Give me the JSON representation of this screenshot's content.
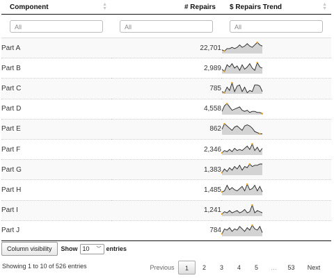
{
  "columns": {
    "component": "Component",
    "repairs": "# Repairs",
    "trend": "$ Repairs Trend"
  },
  "filters": {
    "component": "All",
    "repairs": "All",
    "trend": "All"
  },
  "rows": [
    {
      "component": "Part A",
      "repairs": "22,701",
      "trend": [
        3,
        2,
        4,
        4,
        5,
        4,
        5,
        7,
        5,
        6,
        8,
        6,
        5,
        7,
        9,
        7,
        6
      ]
    },
    {
      "component": "Part B",
      "repairs": "2,989",
      "trend": [
        4,
        2,
        8,
        6,
        9,
        5,
        7,
        3,
        8,
        4,
        6,
        9,
        5,
        3,
        10,
        6,
        5
      ]
    },
    {
      "component": "Part C",
      "repairs": "785",
      "trend": [
        2,
        1,
        6,
        3,
        10,
        2,
        7,
        8,
        2,
        6,
        1,
        3,
        2,
        8,
        8,
        7,
        2
      ]
    },
    {
      "component": "Part D",
      "repairs": "4,558",
      "trend": [
        3,
        8,
        10,
        7,
        4,
        5,
        6,
        7,
        4,
        3,
        4,
        2,
        3,
        3,
        2,
        2,
        1
      ]
    },
    {
      "component": "Part E",
      "repairs": "862",
      "trend": [
        5,
        10,
        8,
        6,
        4,
        7,
        8,
        6,
        4,
        8,
        9,
        8,
        6,
        3,
        2,
        1,
        1
      ]
    },
    {
      "component": "Part F",
      "repairs": "2,346",
      "trend": [
        2,
        4,
        3,
        5,
        3,
        6,
        4,
        5,
        4,
        6,
        8,
        5,
        10,
        4,
        7,
        3,
        6
      ]
    },
    {
      "component": "Part G",
      "repairs": "1,383",
      "trend": [
        2,
        5,
        3,
        6,
        4,
        7,
        5,
        8,
        4,
        7,
        6,
        9,
        7,
        8,
        8,
        9,
        9
      ]
    },
    {
      "component": "Part H",
      "repairs": "1,485",
      "trend": [
        3,
        4,
        9,
        5,
        7,
        5,
        4,
        6,
        8,
        4,
        10,
        5,
        6,
        9,
        4,
        8,
        3
      ]
    },
    {
      "component": "Part I",
      "repairs": "1,241",
      "trend": [
        2,
        4,
        3,
        5,
        3,
        4,
        5,
        3,
        4,
        6,
        3,
        4,
        10,
        3,
        5,
        4,
        3
      ]
    },
    {
      "component": "Part J",
      "repairs": "784",
      "trend": [
        2,
        6,
        5,
        7,
        4,
        6,
        5,
        8,
        6,
        4,
        7,
        5,
        9,
        6,
        5,
        8,
        3
      ]
    }
  ],
  "controls": {
    "column_visibility": "Column visibility",
    "show_label": "Show",
    "page_length": "10",
    "entries_label": "entries"
  },
  "info": "Showing 1 to 10 of 526 entries",
  "pagination": {
    "previous": "Previous",
    "pages": [
      "1",
      "2",
      "3",
      "4",
      "5"
    ],
    "ellipsis": "…",
    "last": "53",
    "next": "Next",
    "current": "1"
  },
  "colors": {
    "spark_fill": "#d3d3d3",
    "spark_line": "#222222",
    "spark_marker": "#f39c12"
  }
}
